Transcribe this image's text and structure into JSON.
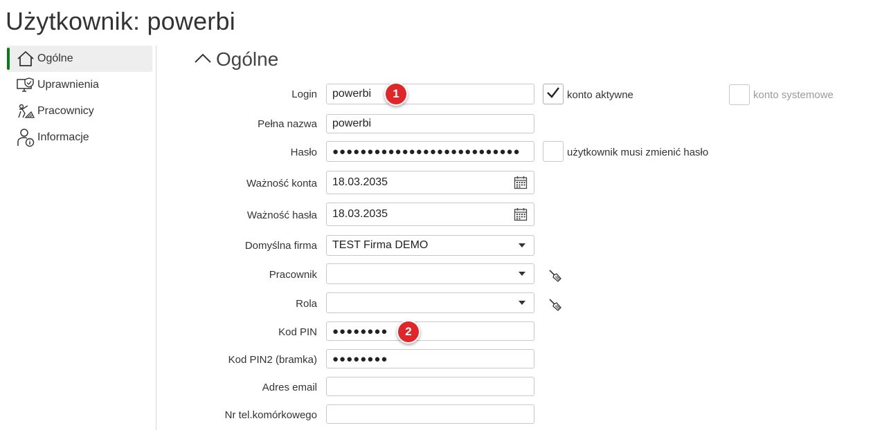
{
  "page_title": "Użytkownik: powerbi",
  "sidebar": {
    "items": [
      {
        "label": "Ogólne",
        "icon": "home-icon",
        "active": true
      },
      {
        "label": "Uprawnienia",
        "icon": "monitor-shield-icon",
        "active": false
      },
      {
        "label": "Pracownicy",
        "icon": "workers-icon",
        "active": false
      },
      {
        "label": "Informacje",
        "icon": "user-info-icon",
        "active": false
      }
    ]
  },
  "section": {
    "title": "Ogólne",
    "icon": "chevron-up-icon"
  },
  "form": {
    "login": {
      "label": "Login",
      "value": "powerbi"
    },
    "full_name": {
      "label": "Pełna nazwa",
      "value": "powerbi"
    },
    "password": {
      "label": "Hasło",
      "value": "●●●●●●●●●●●●●●●●●●●●●●●●●●●"
    },
    "account_validity": {
      "label": "Ważność konta",
      "value": "18.03.2035"
    },
    "password_validity": {
      "label": "Ważność hasła",
      "value": "18.03.2035"
    },
    "default_company": {
      "label": "Domyślna firma",
      "value": "TEST Firma DEMO"
    },
    "employee": {
      "label": "Pracownik",
      "value": ""
    },
    "role": {
      "label": "Rola",
      "value": ""
    },
    "pin": {
      "label": "Kod PIN",
      "value": "●●●●●●●●"
    },
    "pin2": {
      "label": "Kod PIN2 (bramka)",
      "value": "●●●●●●●●"
    },
    "email": {
      "label": "Adres email",
      "value": ""
    },
    "mobile": {
      "label": "Nr tel.komórkowego",
      "value": ""
    }
  },
  "checkboxes": {
    "active_account": {
      "label": "konto aktywne",
      "checked": true
    },
    "system_account": {
      "label": "konto systemowe",
      "checked": false
    },
    "must_change_password": {
      "label": "użytkownik musi zmienić hasło",
      "checked": false
    }
  },
  "badges": {
    "one": "1",
    "two": "2"
  },
  "colors": {
    "accent": "#0a7a16",
    "badge": "#e1262a"
  }
}
